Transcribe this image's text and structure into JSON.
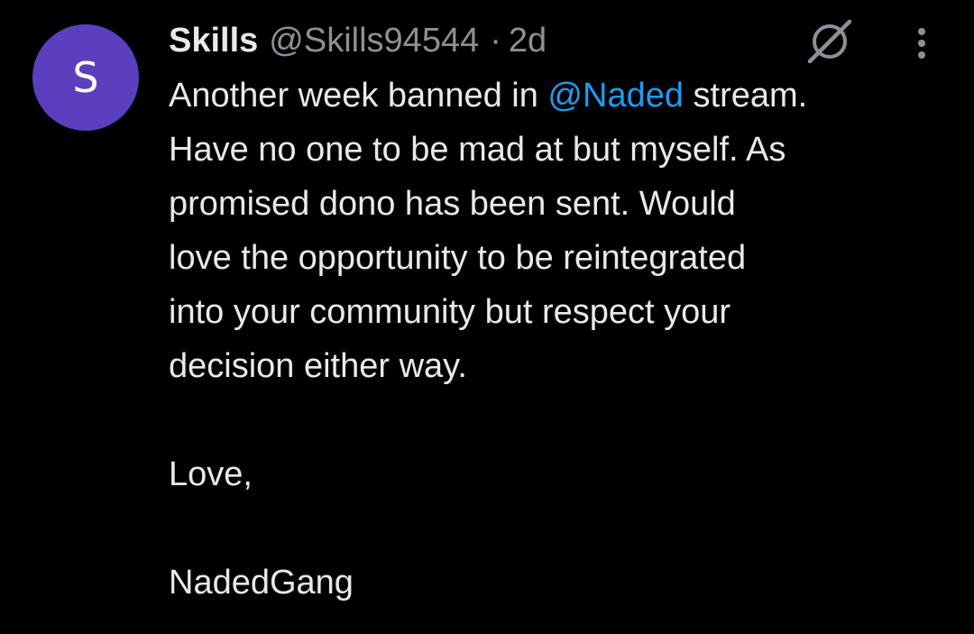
{
  "author": {
    "avatar_letter": "S",
    "avatar_color": "#5b3fbf",
    "display_name": "Skills",
    "handle": "@Skills94544",
    "separator": "·",
    "time": "2d"
  },
  "icons": {
    "grok": "grok-icon",
    "more": "more-vertical-icon"
  },
  "body": {
    "line1_pre": "Another week banned in ",
    "mention": "@Naded",
    "line1_post": " stream.",
    "line2": "Have no one to be mad at but myself. As",
    "line3": "promised dono has been sent. Would",
    "line4": "love the opportunity to be reintegrated",
    "line5": "into your community but respect your",
    "line6": "decision either way.",
    "signoff": "Love,",
    "signature": "NadedGang"
  },
  "colors": {
    "background": "#000000",
    "text": "#e7e9ea",
    "muted": "#8b9197",
    "link": "#1d9bf0"
  }
}
